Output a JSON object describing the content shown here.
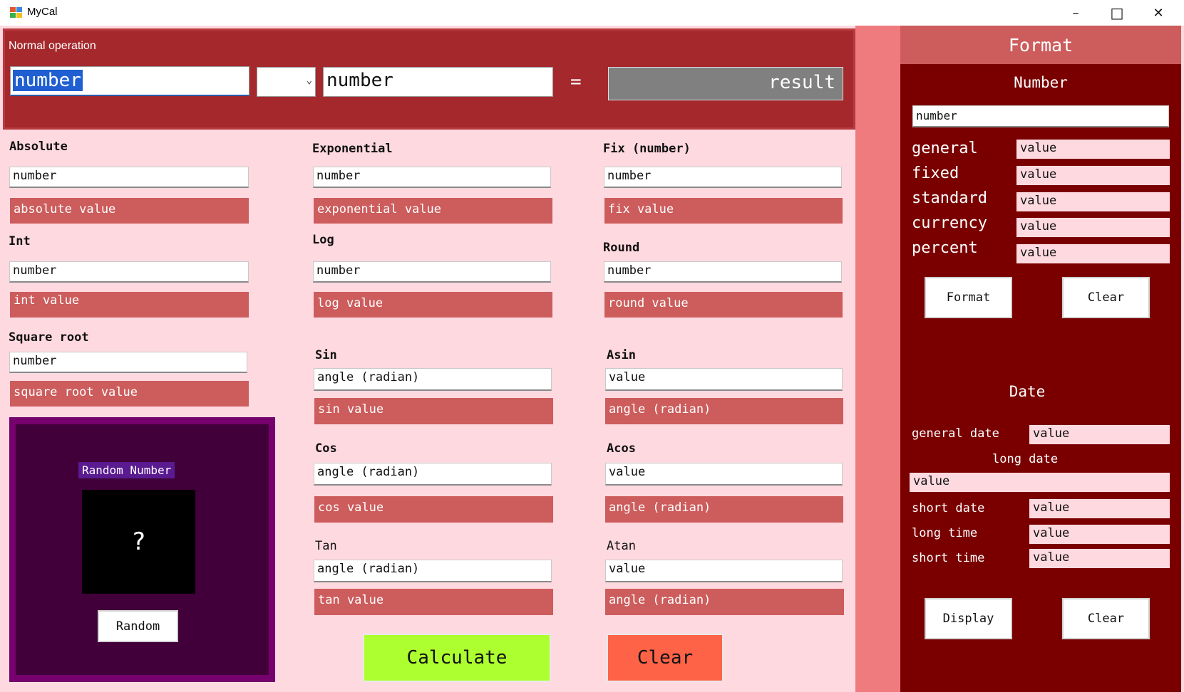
{
  "window": {
    "title": "MyCal",
    "minimize": "–",
    "maximize": "□",
    "close": "✕"
  },
  "normal": {
    "title": "Normal operation",
    "first_value": "number",
    "operator": "",
    "second_value": "number",
    "equals": "=",
    "result": "result"
  },
  "absolute": {
    "label": "Absolute",
    "input": "number",
    "output": "absolute value"
  },
  "exponential": {
    "label": "Exponential",
    "input": "number",
    "output": "exponential value"
  },
  "fix": {
    "label": "Fix (number)",
    "input": "number",
    "output": "fix value"
  },
  "int": {
    "label": "Int",
    "input": "number",
    "output": "int value"
  },
  "log": {
    "label": "Log",
    "input": "number",
    "output": "log value"
  },
  "round": {
    "label": "Round",
    "input": "number",
    "output": "round value"
  },
  "sqrt": {
    "label": "Square root",
    "input": "number",
    "output": "square root value"
  },
  "sin": {
    "label": "Sin",
    "input": "angle (radian)",
    "output": "sin value"
  },
  "asin": {
    "label": "Asin",
    "input": "value",
    "output": "angle (radian)"
  },
  "cos": {
    "label": "Cos",
    "input": "angle (radian)",
    "output": "cos value"
  },
  "acos": {
    "label": "Acos",
    "input": "value",
    "output": "angle (radian)"
  },
  "tan": {
    "label": "Tan",
    "input": "angle (radian)",
    "output": "tan value"
  },
  "atan": {
    "label": "Atan",
    "input": "value",
    "output": "angle (radian)"
  },
  "random": {
    "title": "Random Number",
    "display": "?",
    "button": "Random"
  },
  "actions": {
    "calculate": "Calculate",
    "clear": "Clear"
  },
  "format": {
    "title": "Format",
    "number_title": "Number",
    "number_input": "number",
    "rows": [
      {
        "label": "general",
        "value": "value"
      },
      {
        "label": "fixed",
        "value": "value"
      },
      {
        "label": "standard",
        "value": "value"
      },
      {
        "label": "currency",
        "value": "value"
      },
      {
        "label": "percent",
        "value": "value"
      }
    ],
    "format_button": "Format",
    "clear_button": "Clear",
    "date_title": "Date",
    "general_date": {
      "label": "general date",
      "value": "value"
    },
    "long_date": {
      "label": "long date",
      "value": "value"
    },
    "short_date": {
      "label": "short date",
      "value": "value"
    },
    "long_time": {
      "label": "long time",
      "value": "value"
    },
    "short_time": {
      "label": "short time",
      "value": "value"
    },
    "display_button": "Display",
    "date_clear_button": "Clear"
  },
  "colors": {
    "top_panel": "#a5282c",
    "body_bg": "#ffd9e0",
    "output_bg": "#cd5c5c",
    "format_bg": "#7a0000",
    "calculate_bg": "#adff2f",
    "clear_bg": "#ff6347",
    "random_bg": "#42003a"
  }
}
